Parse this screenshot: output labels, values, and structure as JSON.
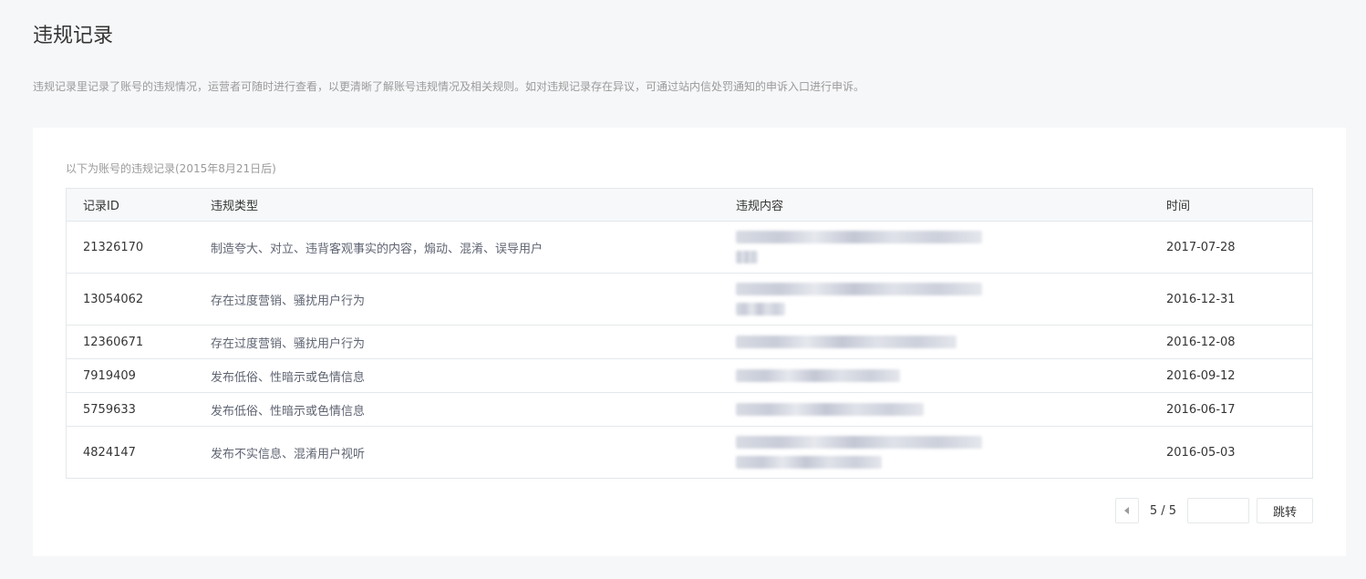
{
  "page": {
    "title": "违规记录",
    "description": "违规记录里记录了账号的违规情况，运营者可随时进行查看，以更清晰了解账号违规情况及相关规则。如对违规记录存在异议，可通过站内信处罚通知的申诉入口进行申诉。"
  },
  "records": {
    "caption": "以下为账号的违规记录(2015年8月21日后)",
    "columns": {
      "id": "记录ID",
      "type": "违规类型",
      "content": "违规内容",
      "time": "时间"
    },
    "rows": [
      {
        "id": "21326170",
        "type": "制造夸大、对立、违背客观事实的内容，煽动、混淆、误导用户",
        "content_lines": 2,
        "time": "2017-07-28"
      },
      {
        "id": "13054062",
        "type": "存在过度营销、骚扰用户行为",
        "content_lines": 2,
        "time": "2016-12-31"
      },
      {
        "id": "12360671",
        "type": "存在过度营销、骚扰用户行为",
        "content_lines": 1,
        "time": "2016-12-08"
      },
      {
        "id": "7919409",
        "type": "发布低俗、性暗示或色情信息",
        "content_lines": 1,
        "time": "2016-09-12"
      },
      {
        "id": "5759633",
        "type": "发布低俗、性暗示或色情信息",
        "content_lines": 1,
        "time": "2016-06-17"
      },
      {
        "id": "4824147",
        "type": "发布不实信息、混淆用户视听",
        "content_lines": 2,
        "time": "2016-05-03"
      }
    ]
  },
  "pager": {
    "info": "5 / 5",
    "input_value": "",
    "go_label": "跳转",
    "prev_icon": "triangle-left-icon"
  }
}
